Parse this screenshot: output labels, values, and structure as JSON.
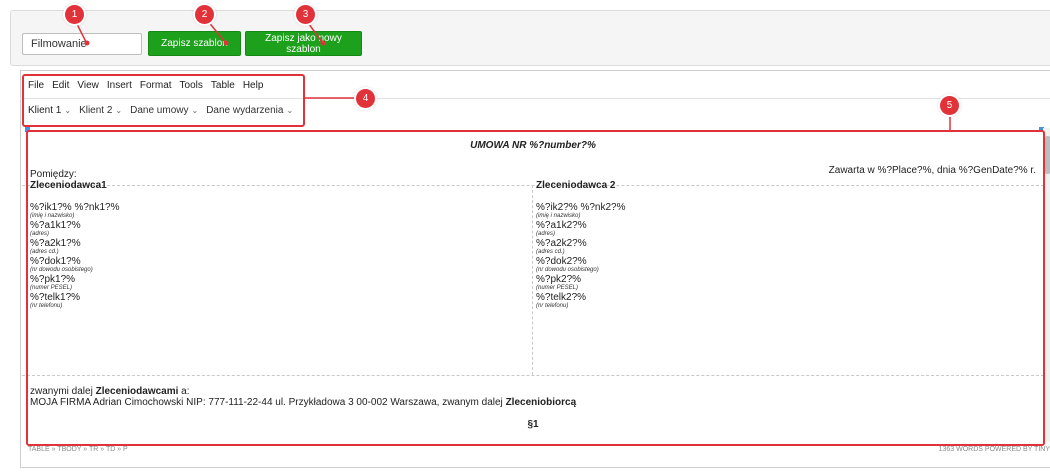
{
  "form": {
    "template_name_value": "Filmowanie",
    "save_label": "Zapisz szablon",
    "save_new_label": "Zapisz jako nowy szablon"
  },
  "colors": {
    "accent_green": "#1da11d",
    "annotation_red": "#e1323a"
  },
  "callouts": [
    "1",
    "2",
    "3",
    "4",
    "5"
  ],
  "menu": [
    "File",
    "Edit",
    "View",
    "Insert",
    "Format",
    "Tools",
    "Table",
    "Help"
  ],
  "toolbar": [
    "Klient 1",
    "Klient 2",
    "Dane umowy",
    "Dane wydarzenia"
  ],
  "doc": {
    "title": "UMOWA NR %?number?%",
    "place_line": "Zawarta w %?Place?%, dnia %?GenDate?% r.",
    "between": "Pomiędzy:",
    "left": {
      "header": "Zleceniodawca1",
      "name": "%?ik1?% %?nk1?%",
      "name_hint": "(imię i nazwisko)",
      "addr": "%?a1k1?%",
      "addr_hint": "(adres)",
      "addr2": "%?a2k1?%",
      "addr2_hint": "(adres cd.)",
      "id": "%?dok1?%",
      "id_hint": "(nr dowodu osobistego)",
      "pesel": "%?pk1?%",
      "pesel_hint": "(numer PESEL)",
      "tel": "%?telk1?%",
      "tel_hint": "(nr telefonu)"
    },
    "right": {
      "header": "Zleceniodawca 2",
      "name": "%?ik2?% %?nk2?%",
      "name_hint": "(imię i nazwisko)",
      "addr": "%?a1k2?%",
      "addr_hint": "(adres)",
      "addr2": "%?a2k2?%",
      "addr2_hint": "(adres cd.)",
      "id": "%?dok2?%",
      "id_hint": "(nr dowodu osobistego)",
      "pesel": "%?pk2?%",
      "pesel_hint": "(numer PESEL)",
      "tel": "%?telk2?%",
      "tel_hint": "(nr telefonu)"
    },
    "called_prefix": "zwanymi dalej ",
    "called_bold": "Zleceniodawcami",
    "called_suffix": " a:",
    "firm_line": "MOJA FIRMA Adrian Cimochowski NIP: 777-111-22-44 ul. Przykładowa 3 00-002 Warszawa, zwanym dalej ",
    "firm_bold": "Zleceniobiorcą",
    "paragraph": "§1"
  },
  "status": {
    "path": "TABLE » TBODY » TR » TD » P",
    "words": "1363 WORDS",
    "powered": "POWERED BY TINY"
  }
}
